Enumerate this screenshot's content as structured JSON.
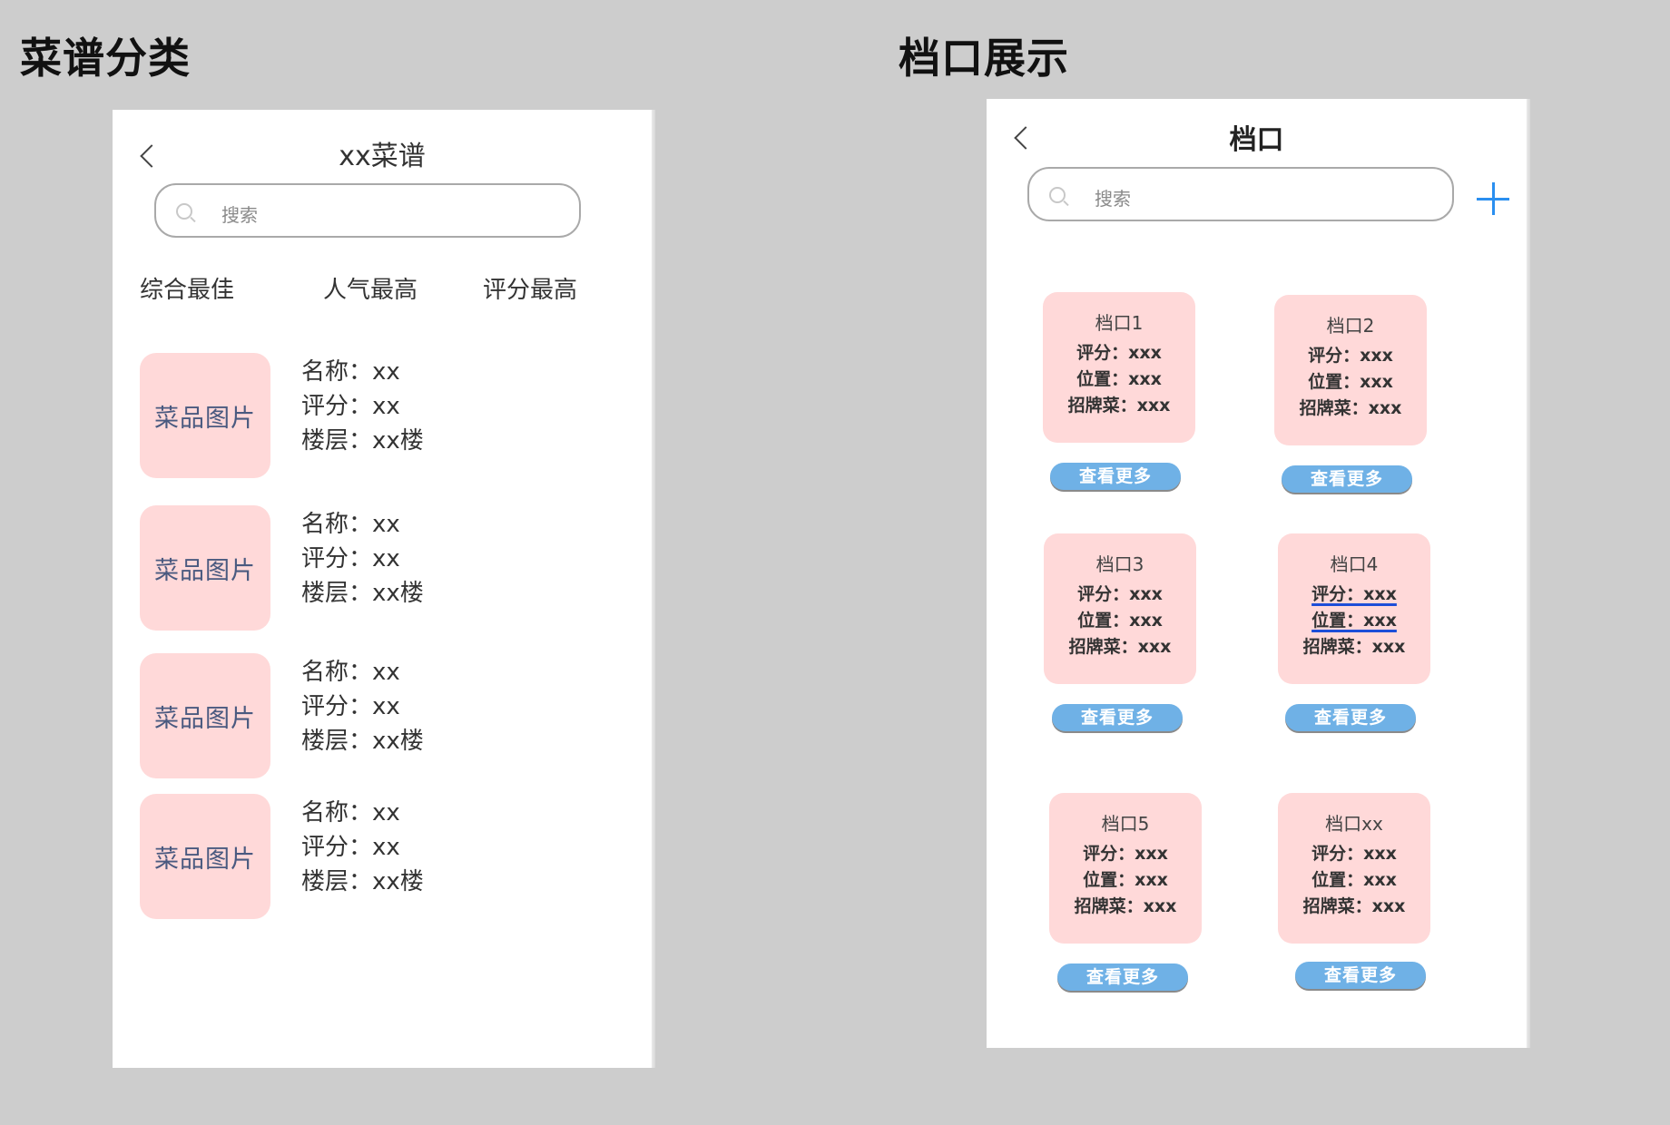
{
  "sections": {
    "left_title": "菜谱分类",
    "right_title": "档口展示"
  },
  "menu_screen": {
    "title": "xx菜谱",
    "search_placeholder": "搜索",
    "sort_tabs": [
      "综合最佳",
      "人气最高",
      "评分最高"
    ],
    "items": [
      {
        "image_label": "菜品图片",
        "name": "名称：xx",
        "rating": "评分：xx",
        "floor": "楼层：xx楼"
      },
      {
        "image_label": "菜品图片",
        "name": "名称：xx",
        "rating": "评分：xx",
        "floor": "楼层：xx楼"
      },
      {
        "image_label": "菜品图片",
        "name": "名称：xx",
        "rating": "评分：xx",
        "floor": "楼层：xx楼"
      },
      {
        "image_label": "菜品图片",
        "name": "名称：xx",
        "rating": "评分：xx",
        "floor": "楼层：xx楼"
      }
    ]
  },
  "stall_screen": {
    "title": "档口",
    "search_placeholder": "搜索",
    "more_label": "查看更多",
    "stalls": [
      {
        "name": "档口1",
        "rating": "评分：xxx",
        "location": "位置：xxx",
        "signature": "招牌菜：xxx"
      },
      {
        "name": "档口2",
        "rating": "评分：xxx",
        "location": "位置：xxx",
        "signature": "招牌菜：xxx"
      },
      {
        "name": "档口3",
        "rating": "评分：xxx",
        "location": "位置：xxx",
        "signature": "招牌菜：xxx"
      },
      {
        "name": "档口4",
        "rating": "评分：xxx",
        "location": "位置：xxx",
        "signature": "招牌菜：xxx"
      },
      {
        "name": "档口5",
        "rating": "评分：xxx",
        "location": "位置：xxx",
        "signature": "招牌菜：xxx"
      },
      {
        "name": "档口xx",
        "rating": "评分：xxx",
        "location": "位置：xxx",
        "signature": "招牌菜：xxx"
      }
    ]
  },
  "colors": {
    "background": "#cdcdcd",
    "card_pink": "#ffd9d9",
    "button_blue": "#6fb1e6",
    "accent_blue": "#2a8ff0"
  }
}
